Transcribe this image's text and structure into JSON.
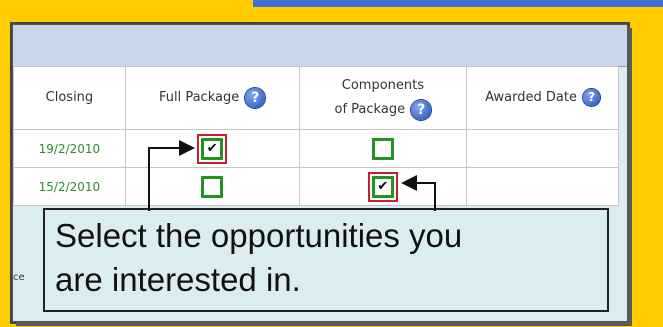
{
  "table": {
    "headers": {
      "closing": "Closing",
      "full_package": "Full Package",
      "components_line1": "Components",
      "components_line2": "of Package",
      "awarded_date": "Awarded Date"
    },
    "help_glyph": "?",
    "rows": [
      {
        "closing": "19/2/2010",
        "full_checked": true,
        "components_checked": false
      },
      {
        "closing": "15/2/2010",
        "full_checked": false,
        "components_checked": true
      }
    ],
    "check_glyph": "✔"
  },
  "callout": {
    "line1": "Select the opportunities you",
    "line2": "are interested in."
  },
  "side_fragment": "ce",
  "colors": {
    "background": "#ffcc00",
    "checkbox_border": "#219421",
    "highlight": "#c0232b",
    "closing_text": "#2f8b2f"
  }
}
